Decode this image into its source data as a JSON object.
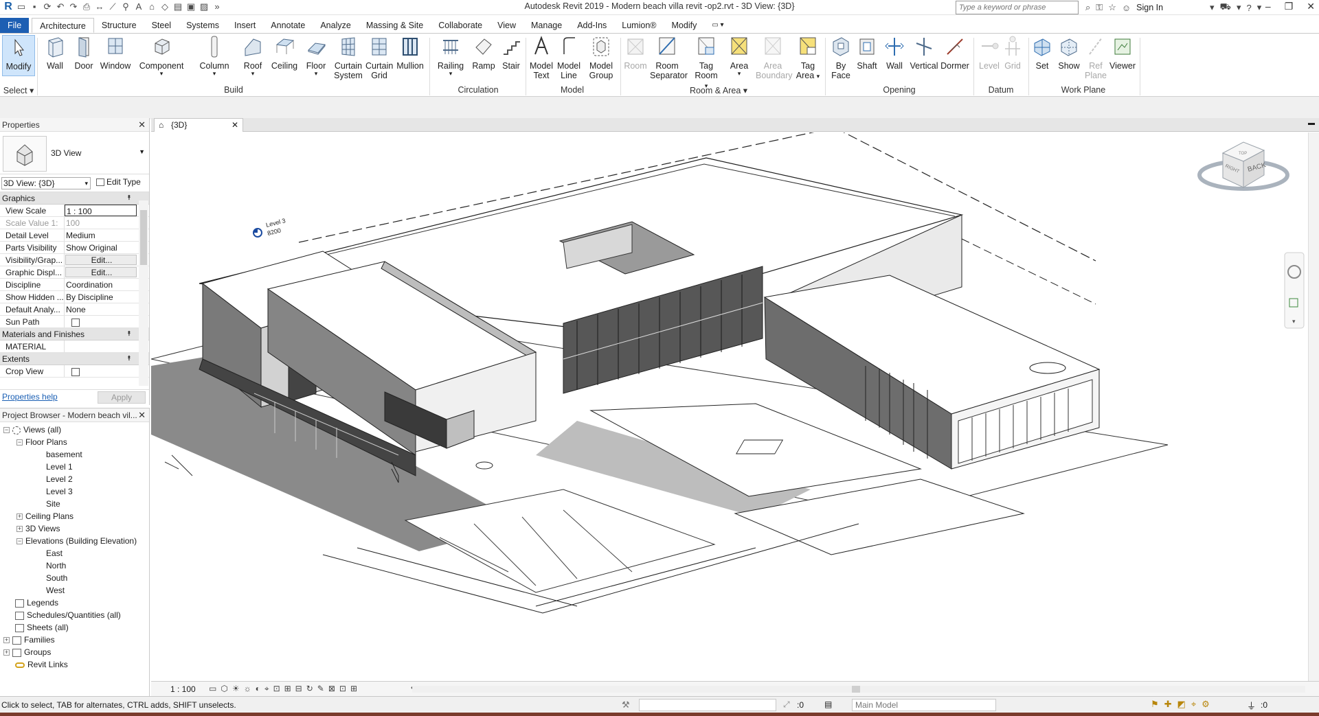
{
  "window": {
    "title": "Autodesk Revit 2019 - Modern beach villa revit -op2.rvt - 3D View: {3D}",
    "search_placeholder": "Type a keyword or phrase",
    "sign_in": "Sign In"
  },
  "ribbon_tabs": [
    "File",
    "Architecture",
    "Structure",
    "Steel",
    "Systems",
    "Insert",
    "Annotate",
    "Analyze",
    "Massing & Site",
    "Collaborate",
    "View",
    "Manage",
    "Add-Ins",
    "Lumion®",
    "Modify"
  ],
  "active_tab": "Architecture",
  "ribbon": {
    "select_label": "Select",
    "tools": {
      "modify": "Modify",
      "wall": "Wall",
      "door": "Door",
      "window": "Window",
      "component": "Component",
      "column": "Column",
      "roof": "Roof",
      "ceiling": "Ceiling",
      "floor": "Floor",
      "curtain_system": "Curtain System",
      "curtain_grid": "Curtain Grid",
      "mullion": "Mullion",
      "railing": "Railing",
      "ramp": "Ramp",
      "stair": "Stair",
      "model_text": "Model Text",
      "model_line": "Model Line",
      "model_group": "Model Group",
      "room": "Room",
      "room_separator": "Room Separator",
      "tag_room": "Tag Room",
      "area": "Area",
      "area_boundary": "Area Boundary",
      "tag_area": "Tag Area",
      "by_face": "By Face",
      "shaft": "Shaft",
      "opening_wall": "Wall",
      "vertical": "Vertical",
      "dormer": "Dormer",
      "level": "Level",
      "grid": "Grid",
      "set": "Set",
      "show": "Show",
      "ref_plane": "Ref Plane",
      "viewer": "Viewer"
    },
    "panels": {
      "build": "Build",
      "circulation": "Circulation",
      "model": "Model",
      "room_area": "Room & Area",
      "opening": "Opening",
      "datum": "Datum",
      "work_plane": "Work Plane"
    }
  },
  "properties": {
    "title": "Properties",
    "type_name": "3D View",
    "instance_selector": "3D View: {3D}",
    "edit_type": "Edit Type",
    "groups": {
      "graphics": "Graphics",
      "materials": "Materials and Finishes",
      "extents": "Extents"
    },
    "rows": {
      "view_scale": {
        "k": "View Scale",
        "v": "1 : 100"
      },
      "scale_value": {
        "k": "Scale Value    1:",
        "v": "100"
      },
      "detail_level": {
        "k": "Detail Level",
        "v": "Medium"
      },
      "parts_visibility": {
        "k": "Parts Visibility",
        "v": "Show Original"
      },
      "visibility_graphics": {
        "k": "Visibility/Grap...",
        "v": "Edit..."
      },
      "graphic_display": {
        "k": "Graphic Displ...",
        "v": "Edit..."
      },
      "discipline": {
        "k": "Discipline",
        "v": "Coordination"
      },
      "show_hidden": {
        "k": "Show Hidden ...",
        "v": "By Discipline"
      },
      "default_analysis": {
        "k": "Default Analy...",
        "v": "None"
      },
      "sun_path": {
        "k": "Sun Path",
        "v": ""
      },
      "material": {
        "k": "MATERIAL",
        "v": ""
      },
      "crop_view": {
        "k": "Crop View",
        "v": ""
      }
    },
    "help_link": "Properties help",
    "apply": "Apply"
  },
  "project_browser": {
    "title": "Project Browser - Modern beach vil...",
    "nodes": {
      "views_all": "Views (all)",
      "floor_plans": "Floor Plans",
      "basement": "basement",
      "level1": "Level 1",
      "level2": "Level 2",
      "level3": "Level 3",
      "site": "Site",
      "ceiling_plans": "Ceiling Plans",
      "views_3d": "3D Views",
      "elevations": "Elevations (Building Elevation)",
      "east": "East",
      "north": "North",
      "south": "South",
      "west": "West",
      "legends": "Legends",
      "schedules": "Schedules/Quantities (all)",
      "sheets": "Sheets (all)",
      "families": "Families",
      "groups": "Groups",
      "revit_links": "Revit Links"
    }
  },
  "view_tab": {
    "label": "{3D}"
  },
  "viewcube": {
    "front": "BACK",
    "side": "RIGHT",
    "top": "TOP"
  },
  "level_tag": {
    "name": "Level 3",
    "elevation": "8200"
  },
  "view_control": {
    "scale": "1 : 100"
  },
  "status": {
    "hint": "Click to select, TAB for alternates, CTRL adds, SHIFT unselects.",
    "selection_count": ":0",
    "main_model": "Main Model",
    "filter_count": ":0"
  },
  "colors": {
    "file_tab": "#1d5fb3",
    "accent_blue": "#1a5fb4",
    "status_bottom": "#7a3b2c"
  }
}
